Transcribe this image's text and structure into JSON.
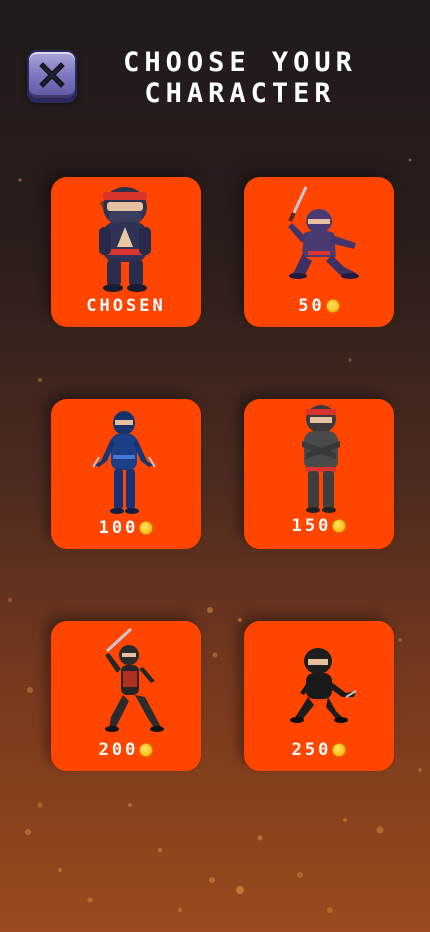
{
  "header": {
    "title_line1": "CHOOSE YOUR",
    "title_line2": "CHARACTER"
  },
  "characters": [
    {
      "label": "CHOSEN",
      "price": "",
      "coin": false
    },
    {
      "label": "",
      "price": "50",
      "coin": true
    },
    {
      "label": "",
      "price": "100",
      "coin": true
    },
    {
      "label": "",
      "price": "150",
      "coin": true
    },
    {
      "label": "",
      "price": "200",
      "coin": true
    },
    {
      "label": "",
      "price": "250",
      "coin": true
    }
  ],
  "colors": {
    "card": "#ff4500",
    "coin": "#ffc21a",
    "close_button": "#7d78c0"
  }
}
